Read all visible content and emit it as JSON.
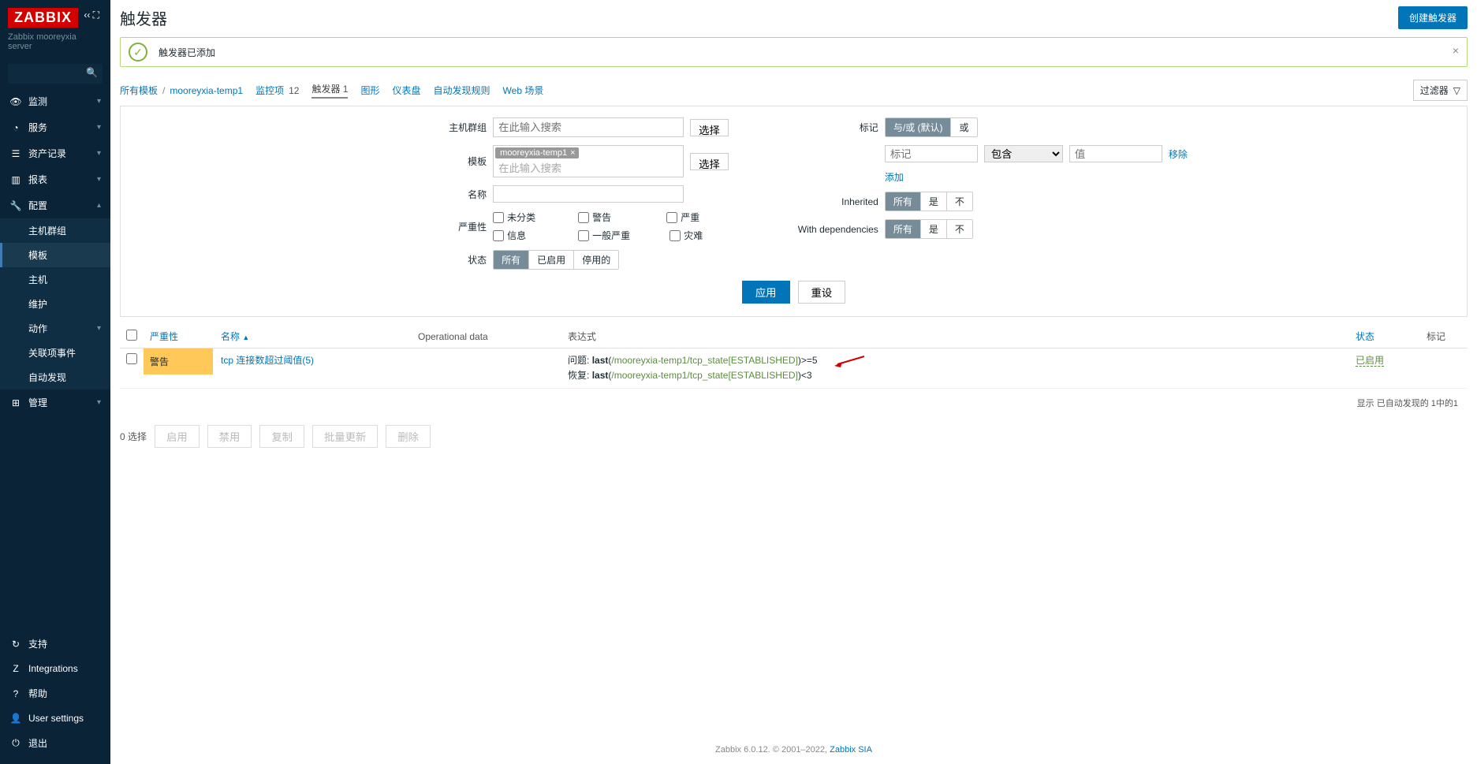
{
  "brand": "ZABBIX",
  "server_name": "Zabbix mooreyxia server",
  "nav": {
    "monitor": "监测",
    "services": "服务",
    "inventory": "资产记录",
    "reports": "报表",
    "config": "配置",
    "admin": "管理",
    "support": "支持",
    "integrations": "Integrations",
    "help": "帮助",
    "user_settings": "User settings",
    "logout": "退出"
  },
  "config_sub": {
    "hostgroups": "主机群组",
    "templates": "模板",
    "hosts": "主机",
    "maintenance": "维护",
    "actions": "动作",
    "correlation": "关联项事件",
    "discovery": "自动发现"
  },
  "page": {
    "title": "触发器",
    "create_btn": "创建触发器"
  },
  "msg": {
    "text": "触发器已添加"
  },
  "breadcrumb": {
    "all_templates": "所有模板",
    "template_name": "mooreyxia-temp1",
    "items": "监控项",
    "items_cnt": "12",
    "triggers": "触发器",
    "triggers_cnt": "1",
    "graphs": "图形",
    "dashboards": "仪表盘",
    "discovery": "自动发现规则",
    "web": "Web 场景",
    "filter_label": "过滤器"
  },
  "filter": {
    "hostgroups": "主机群组",
    "template": "模板",
    "name": "名称",
    "severity": "严重性",
    "status": "状态",
    "tags": "标记",
    "inherited": "Inherited",
    "dependencies": "With dependencies",
    "placeholder_search": "在此输入搜索",
    "template_chip": "mooreyxia-temp1",
    "tag_placeholder": "标记",
    "value_placeholder": "值",
    "contains": "包含",
    "remove": "移除",
    "add": "添加",
    "select": "选择",
    "andor_default": "与/或 (默认)",
    "or": "或",
    "all": "所有",
    "yes": "是",
    "no": "不",
    "enabled": "已启用",
    "disabled": "停用的",
    "sev_unclassified": "未分类",
    "sev_info": "信息",
    "sev_warning": "警告",
    "sev_avg": "一般严重",
    "sev_high": "严重",
    "sev_disaster": "灾难",
    "apply": "应用",
    "reset": "重设"
  },
  "table": {
    "col_severity": "严重性",
    "col_name": "名称",
    "col_opdata": "Operational data",
    "col_expr": "表达式",
    "col_status": "状态",
    "col_tags": "标记"
  },
  "row": {
    "severity": "警告",
    "name": "tcp 连接数超过阈值(5)",
    "problem_label": "问题:",
    "recovery_label": "恢复:",
    "last": "last",
    "expr_link1": "/mooreyxia-temp1/tcp_state[ESTABLISHED]",
    "expr_suffix1": ")>=5",
    "expr_link2": "/mooreyxia-temp1/tcp_state[ESTABLISHED]",
    "expr_suffix2": ")<3",
    "status": "已启用"
  },
  "table_footer": "显示 已自动发现的 1中的1",
  "bottom": {
    "selection": "0 选择",
    "enable": "启用",
    "disable": "禁用",
    "copy": "复制",
    "massupdate": "批量更新",
    "delete": "删除"
  },
  "footer": {
    "version": "Zabbix 6.0.12. © 2001–2022, ",
    "company": "Zabbix SIA"
  }
}
